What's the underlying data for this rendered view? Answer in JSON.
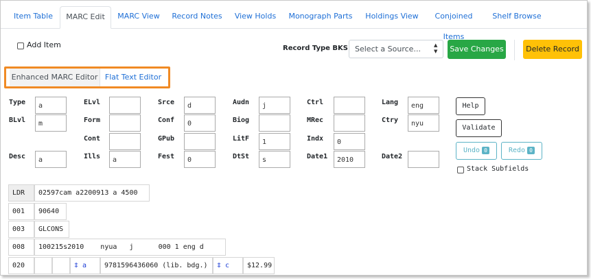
{
  "tabs": [
    {
      "label": "Item Table",
      "active": false
    },
    {
      "label": "MARC Edit",
      "active": true
    },
    {
      "label": "MARC View",
      "active": false
    },
    {
      "label": "Record Notes",
      "active": false
    },
    {
      "label": "View Holds",
      "active": false
    },
    {
      "label": "Monograph Parts",
      "active": false
    },
    {
      "label": "Holdings View",
      "active": false
    },
    {
      "label": "Conjoined Items",
      "active": false
    },
    {
      "label": "Shelf Browse",
      "active": false
    }
  ],
  "toolbar": {
    "add_item_label": "Add Item",
    "record_type_label": "Record Type BKS",
    "source_placeholder": "Select a Source...",
    "save_label": "Save Changes",
    "delete_label": "Delete Record"
  },
  "editor_tabs": {
    "enhanced": "Enhanced MARC Editor",
    "flat": "Flat Text Editor"
  },
  "fixed_fields": {
    "type": {
      "label": "Type",
      "value": "a"
    },
    "elvl": {
      "label": "ELvl",
      "value": ""
    },
    "srce": {
      "label": "Srce",
      "value": "d"
    },
    "audn": {
      "label": "Audn",
      "value": "j"
    },
    "ctrl": {
      "label": "Ctrl",
      "value": ""
    },
    "lang": {
      "label": "Lang",
      "value": "eng"
    },
    "blvl": {
      "label": "BLvl",
      "value": "m"
    },
    "form": {
      "label": "Form",
      "value": ""
    },
    "conf": {
      "label": "Conf",
      "value": "0"
    },
    "biog": {
      "label": "Biog",
      "value": ""
    },
    "mrec": {
      "label": "MRec",
      "value": ""
    },
    "ctry": {
      "label": "Ctry",
      "value": "nyu"
    },
    "cont": {
      "label": "Cont",
      "value": ""
    },
    "gpub": {
      "label": "GPub",
      "value": ""
    },
    "litf": {
      "label": "LitF",
      "value": "1"
    },
    "indx": {
      "label": "Indx",
      "value": "0"
    },
    "desc": {
      "label": "Desc",
      "value": "a"
    },
    "ills": {
      "label": "Ills",
      "value": "a"
    },
    "fest": {
      "label": "Fest",
      "value": "0"
    },
    "dtst": {
      "label": "DtSt",
      "value": "s"
    },
    "date1": {
      "label": "Date1",
      "value": "2010"
    },
    "date2": {
      "label": "Date2",
      "value": ""
    }
  },
  "side_buttons": {
    "help": "Help",
    "validate": "Validate",
    "undo": "Undo",
    "undo_count": "0",
    "redo": "Redo",
    "redo_count": "0",
    "stack_label": "Stack Subfields"
  },
  "marc": {
    "ldr": {
      "tag": "LDR",
      "value": "02597cam a2200913 a 4500"
    },
    "f001": {
      "tag": "001",
      "value": "90640"
    },
    "f003": {
      "tag": "003",
      "value": "GLCONS"
    },
    "f008": {
      "tag": "008",
      "value": "100215s2010    nyua   j      000 1 eng d"
    },
    "f020": {
      "tag": "020",
      "ind1": "",
      "ind2": "",
      "sub1_code": "‡ a",
      "sub1_value": "9781596436060 (lib. bdg.) :",
      "sub2_code": "‡ c",
      "sub2_value": "$12.99"
    }
  },
  "colors": {
    "link": "#1e6fd6",
    "save": "#28a745",
    "delete": "#ffc107",
    "highlight": "#f08a24",
    "info": "#5cb3c6"
  }
}
